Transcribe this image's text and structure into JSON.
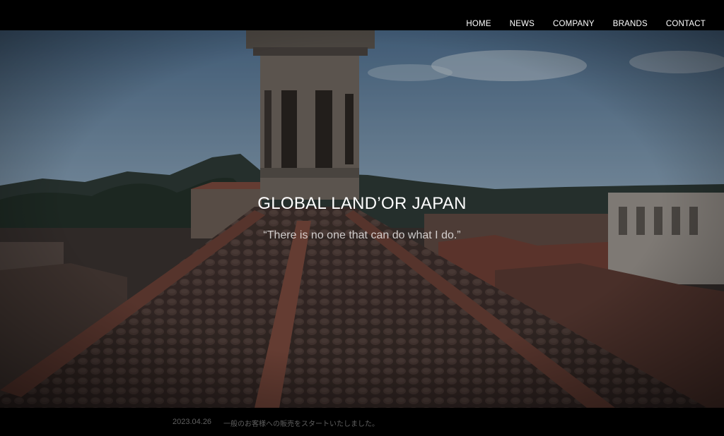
{
  "nav": {
    "items": [
      {
        "label": "HOME"
      },
      {
        "label": "NEWS"
      },
      {
        "label": "COMPANY"
      },
      {
        "label": "BRANDS"
      },
      {
        "label": "CONTACT"
      }
    ]
  },
  "hero": {
    "title": "GLOBAL LAND’OR JAPAN",
    "tagline": "“There is no one that can do what I do.”"
  },
  "news": {
    "date": "2023.04.26",
    "text": "一般のお客様への販売をスタートいたしました。"
  }
}
